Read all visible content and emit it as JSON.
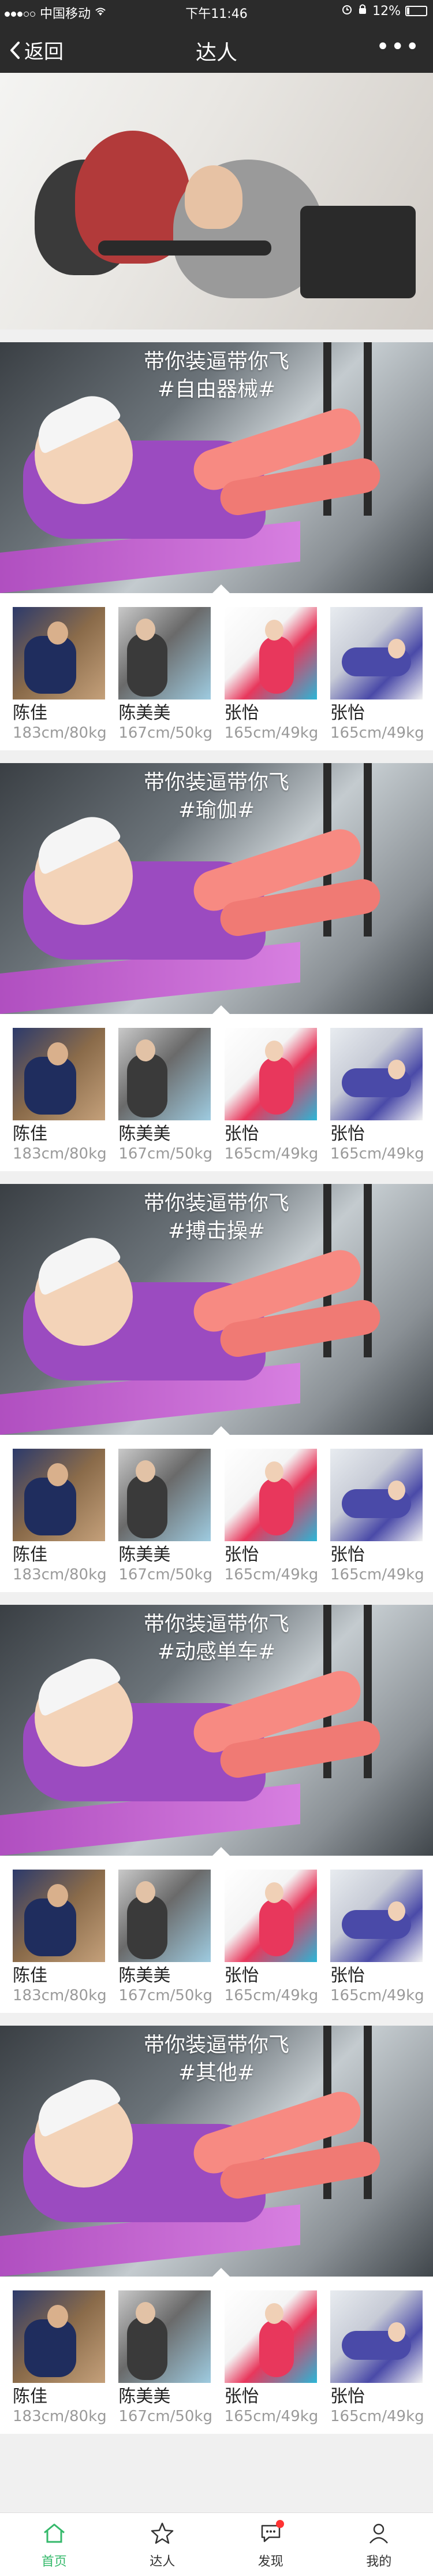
{
  "status": {
    "carrier": "中国移动",
    "time": "下午11:46",
    "battery": "12%",
    "battery_level": 0.12
  },
  "nav": {
    "back_label": "返回",
    "title": "达人",
    "more_label": "•••"
  },
  "sections": [
    {
      "slogan": "带你装逼带你飞",
      "tag": "#自由器械#",
      "experts": [
        {
          "name": "陈佳",
          "stat": "183cm/80kg"
        },
        {
          "name": "陈美美",
          "stat": "167cm/50kg"
        },
        {
          "name": "张怡",
          "stat": "165cm/49kg"
        },
        {
          "name": "张怡",
          "stat": "165cm/49kg"
        }
      ]
    },
    {
      "slogan": "带你装逼带你飞",
      "tag": "#瑜伽#",
      "experts": [
        {
          "name": "陈佳",
          "stat": "183cm/80kg"
        },
        {
          "name": "陈美美",
          "stat": "167cm/50kg"
        },
        {
          "name": "张怡",
          "stat": "165cm/49kg"
        },
        {
          "name": "张怡",
          "stat": "165cm/49kg"
        }
      ]
    },
    {
      "slogan": "带你装逼带你飞",
      "tag": "#搏击操#",
      "experts": [
        {
          "name": "陈佳",
          "stat": "183cm/80kg"
        },
        {
          "name": "陈美美",
          "stat": "167cm/50kg"
        },
        {
          "name": "张怡",
          "stat": "165cm/49kg"
        },
        {
          "name": "张怡",
          "stat": "165cm/49kg"
        }
      ]
    },
    {
      "slogan": "带你装逼带你飞",
      "tag": "#动感单车#",
      "experts": [
        {
          "name": "陈佳",
          "stat": "183cm/80kg"
        },
        {
          "name": "陈美美",
          "stat": "167cm/50kg"
        },
        {
          "name": "张怡",
          "stat": "165cm/49kg"
        },
        {
          "name": "张怡",
          "stat": "165cm/49kg"
        }
      ]
    },
    {
      "slogan": "带你装逼带你飞",
      "tag": "#其他#",
      "experts": [
        {
          "name": "陈佳",
          "stat": "183cm/80kg"
        },
        {
          "name": "陈美美",
          "stat": "167cm/50kg"
        },
        {
          "name": "张怡",
          "stat": "165cm/49kg"
        },
        {
          "name": "张怡",
          "stat": "165cm/49kg"
        }
      ]
    }
  ],
  "tabbar": {
    "items": [
      {
        "label": "首页",
        "icon": "home-icon",
        "active": true
      },
      {
        "label": "达人",
        "icon": "star-icon",
        "active": false
      },
      {
        "label": "发现",
        "icon": "chat-icon",
        "active": false
      },
      {
        "label": "我的",
        "icon": "person-icon",
        "active": false
      }
    ]
  },
  "colors": {
    "header_bg": "#2b2b2b",
    "accent_green": "#35b96b",
    "stat_gray": "#9a9a9a"
  }
}
